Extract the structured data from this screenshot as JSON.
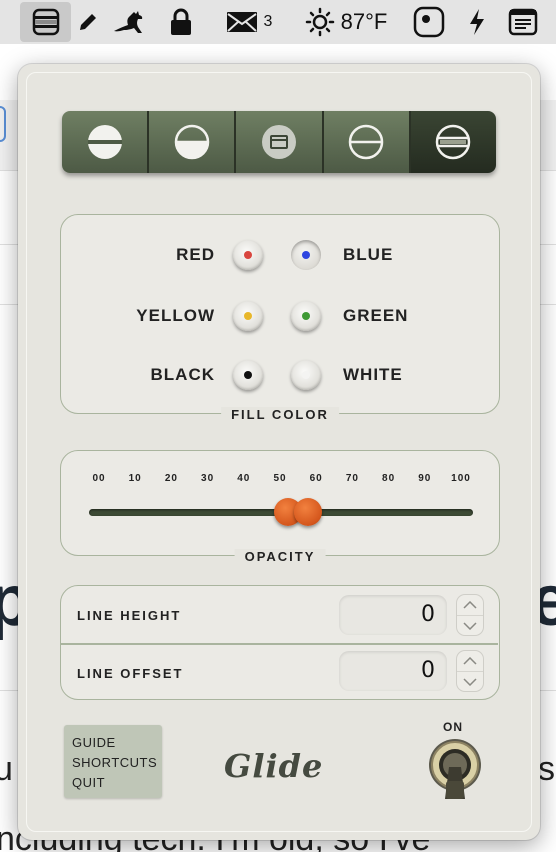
{
  "menubar": {
    "items": [
      {
        "icon": "glide-menu-icon"
      },
      {
        "icon": "pencil-icon"
      },
      {
        "icon": "kangaroo-icon"
      },
      {
        "icon": "lock-icon"
      },
      {
        "icon": "mail-icon",
        "count": "3"
      },
      {
        "icon": "sun-icon",
        "temperature": "87°F"
      },
      {
        "icon": "app-icon"
      },
      {
        "icon": "bolt-icon"
      },
      {
        "icon": "notes-icon"
      }
    ]
  },
  "background": {
    "big_left": "p",
    "big_right": "es",
    "text_line_1": "u",
    "text_line_1_right": "s",
    "text_line_2": "ncluding tech. I'm old, so I've"
  },
  "segmented": {
    "options": [
      "line-top-fill",
      "line-center-fill",
      "window-icon",
      "line-thin-center",
      "line-double"
    ],
    "selected_index": 4
  },
  "fill_color": {
    "label": "FILL COLOR",
    "colors": [
      {
        "name": "RED",
        "hex": "#d9463f"
      },
      {
        "name": "BLUE",
        "hex": "#2e45e0"
      },
      {
        "name": "YELLOW",
        "hex": "#e8b72a"
      },
      {
        "name": "GREEN",
        "hex": "#3f9a35"
      },
      {
        "name": "BLACK",
        "hex": "#111111"
      },
      {
        "name": "WHITE",
        "hex": "#f4f4f2"
      }
    ],
    "selected": "BLUE"
  },
  "opacity": {
    "label": "OPACITY",
    "ticks": [
      "00",
      "10",
      "20",
      "30",
      "40",
      "50",
      "60",
      "70",
      "80",
      "90",
      "100"
    ],
    "value": 55
  },
  "line_settings": {
    "line_height_label": "LINE HEIGHT",
    "line_height_value": "0",
    "line_offset_label": "LINE OFFSET",
    "line_offset_value": "0"
  },
  "menu": {
    "items": [
      "GUIDE",
      "SHORTCUTS",
      "QUIT"
    ]
  },
  "logo": "Glide",
  "toggle": {
    "label": "ON",
    "state": "on"
  },
  "colors": {
    "accent_green": "#4d5a45",
    "slider_orange": "#d4561c",
    "popover_bg": "#e6e5df"
  }
}
